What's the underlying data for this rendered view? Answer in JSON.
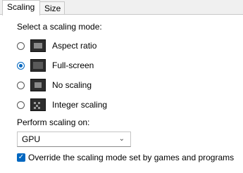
{
  "tabs": [
    {
      "label": "Scaling",
      "active": true
    },
    {
      "label": "Size",
      "active": false
    }
  ],
  "prompt_label": "Select a scaling mode:",
  "modes": [
    {
      "label": "Aspect ratio",
      "icon": "aspect-ratio-icon",
      "checked": false
    },
    {
      "label": "Full-screen",
      "icon": "full-screen-icon",
      "checked": true
    },
    {
      "label": "No scaling",
      "icon": "no-scaling-icon",
      "checked": false
    },
    {
      "label": "Integer scaling",
      "icon": "integer-scaling-icon",
      "checked": false
    }
  ],
  "perform_label": "Perform scaling on:",
  "perform_select": {
    "value": "GPU"
  },
  "override": {
    "label": "Override the scaling mode set by games and programs",
    "checked": true
  },
  "colors": {
    "accent": "#0067c0"
  }
}
